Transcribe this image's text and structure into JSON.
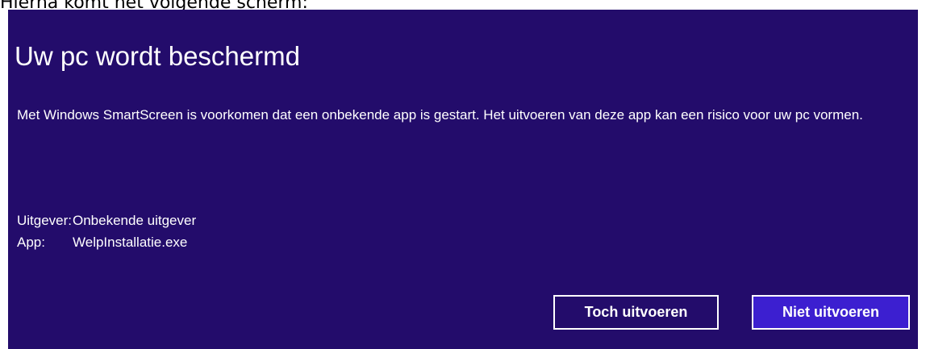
{
  "caption": "Hierna komt het volgende scherm:",
  "dialog": {
    "title": "Uw pc wordt beschermd",
    "message": "Met Windows SmartScreen is voorkomen dat een onbekende app is gestart. Het uitvoeren van deze app kan een risico voor uw pc vormen.",
    "publisher_label": "Uitgever:",
    "publisher_value": "Onbekende uitgever",
    "app_label": "App:",
    "app_value": "WelpInstallatie.exe",
    "run_anyway_label": "Toch uitvoeren",
    "dont_run_label": "Niet uitvoeren"
  },
  "colors": {
    "dialog_background": "#230c6b",
    "primary_button": "#3c1fd0",
    "text": "#ffffff"
  }
}
